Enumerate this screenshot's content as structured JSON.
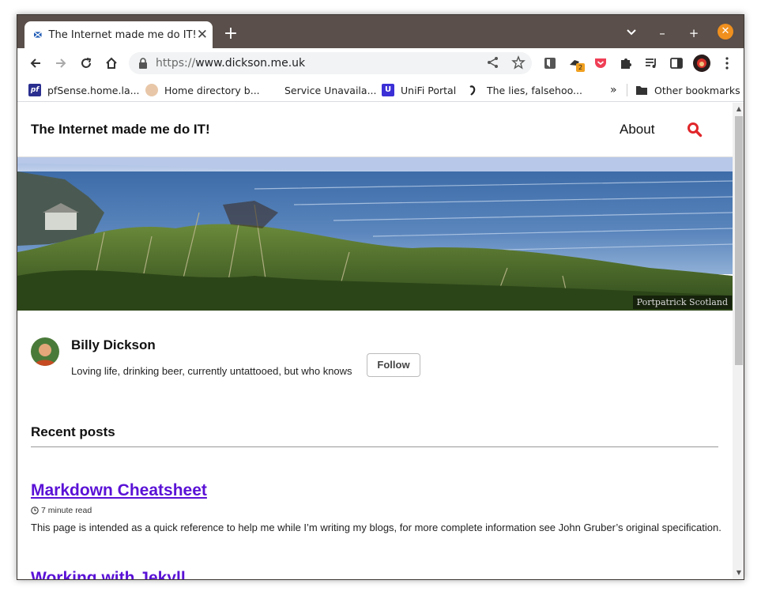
{
  "browser": {
    "tab_title": "The Internet made me do IT!",
    "url_scheme": "https://",
    "url_host": "www.dickson.me.uk",
    "extension_badge": "2",
    "accent_color": "#f0901e"
  },
  "bookmarks": {
    "items": [
      {
        "label": "pfSense.home.la...",
        "icon": "pfsense-icon"
      },
      {
        "label": "Home directory b...",
        "icon": "face-icon"
      },
      {
        "label": "Service Unavaila...",
        "icon": "blank-icon"
      },
      {
        "label": "UniFi Portal",
        "icon": "unifi-icon"
      },
      {
        "label": "The lies, falsehoo...",
        "icon": "bird-icon"
      }
    ],
    "overflow": "»",
    "other": "Other bookmarks"
  },
  "site": {
    "title": "The Internet made me do IT!",
    "nav_about": "About",
    "hero_caption": "Portpatrick Scotland",
    "link_color": "#5a11d6",
    "search_color": "#e0262a"
  },
  "author": {
    "name": "Billy Dickson",
    "bio": "Loving life, drinking beer, currently untattooed, but who knows",
    "follow_label": "Follow"
  },
  "recent": {
    "heading": "Recent posts",
    "posts": [
      {
        "title": "Markdown Cheatsheet",
        "read_time": "7 minute read",
        "excerpt": "This page is intended as a quick reference to help me while I’m writing my blogs, for more complete information see John Gruber’s original specification."
      },
      {
        "title": "Working with Jekyll"
      }
    ]
  }
}
